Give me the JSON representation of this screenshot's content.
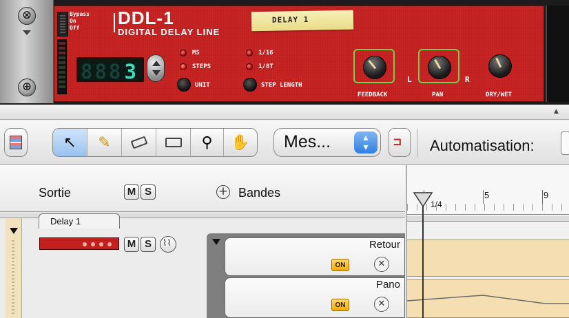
{
  "device": {
    "name": "DDL-1",
    "subtitle": "DIGITAL DELAY LINE",
    "patch_name": "DELAY 1",
    "bypass_labels": [
      "Bypass",
      "On",
      "Off"
    ],
    "lcd_value": "3",
    "lcd_ghost": "888",
    "mode_options": [
      "MS",
      "STEPS"
    ],
    "unit_label": "UNIT",
    "step_options": [
      "1/16",
      "1/8T"
    ],
    "step_length_label": "STEP LENGTH",
    "knobs": [
      {
        "label": "FEEDBACK",
        "selected": true
      },
      {
        "label": "PAN",
        "selected": true,
        "side_left": "L",
        "side_right": "R"
      },
      {
        "label": "DRY/WET",
        "selected": false
      }
    ],
    "panel_color": "#c21f1f"
  },
  "toolbar": {
    "popup_value": "Mes...",
    "automation_label": "Automatisation:",
    "accent_color": "#2f7fe0"
  },
  "tracks_header": {
    "output_label": "Sortie",
    "mute": "M",
    "solo": "S",
    "lanes_label": "Bandes"
  },
  "track": {
    "name": "Delay 1",
    "mute": "M",
    "solo": "S",
    "lanes": [
      {
        "name": "Retour",
        "on": "ON"
      },
      {
        "name": "Pano",
        "on": "ON"
      }
    ]
  },
  "ruler": {
    "bars": [
      "1",
      "5",
      "9"
    ],
    "sub_label": "1/4"
  }
}
